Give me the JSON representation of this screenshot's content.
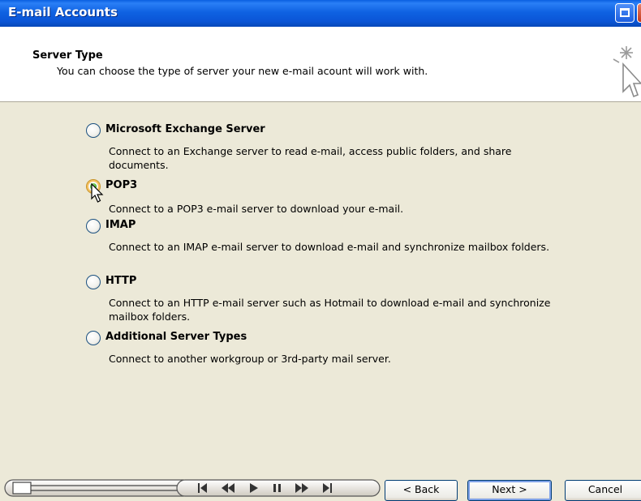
{
  "window": {
    "title": "E-mail Accounts"
  },
  "header": {
    "title": "Server Type",
    "subtitle": "You can choose the type of server your new e-mail acount will work with."
  },
  "options": [
    {
      "label": "Microsoft Exchange Server",
      "description": "Connect to an Exchange server to read e-mail, access public folders, and share documents.",
      "selected": false
    },
    {
      "label": "POP3",
      "description": "Connect to a POP3 e-mail server to download your e-mail.",
      "selected": true
    },
    {
      "label": "IMAP",
      "description": "Connect to an IMAP e-mail server to download e-mail and synchronize mailbox folders.",
      "selected": false
    },
    {
      "label": "HTTP",
      "description": "Connect to an HTTP e-mail server such as Hotmail to download e-mail and synchronize mailbox folders.",
      "selected": false
    },
    {
      "label": "Additional Server Types",
      "description": "Connect to another workgroup or 3rd-party mail server.",
      "selected": false
    }
  ],
  "buttons": {
    "back": "< Back",
    "next": "Next >",
    "cancel": "Cancel"
  },
  "icons": {
    "wizard": "wizard-sparkle-cursor-icon",
    "restore": "restore-window-icon",
    "close": "close-window-icon",
    "player": [
      "seek-slider",
      "skip-back-icon",
      "rewind-icon",
      "play-icon",
      "pause-icon",
      "fast-forward-icon",
      "skip-forward-icon"
    ]
  },
  "colors": {
    "titlebar": "#0b55d6",
    "dialog_bg": "#ece9d8",
    "selected_radio": "#44b52a"
  }
}
